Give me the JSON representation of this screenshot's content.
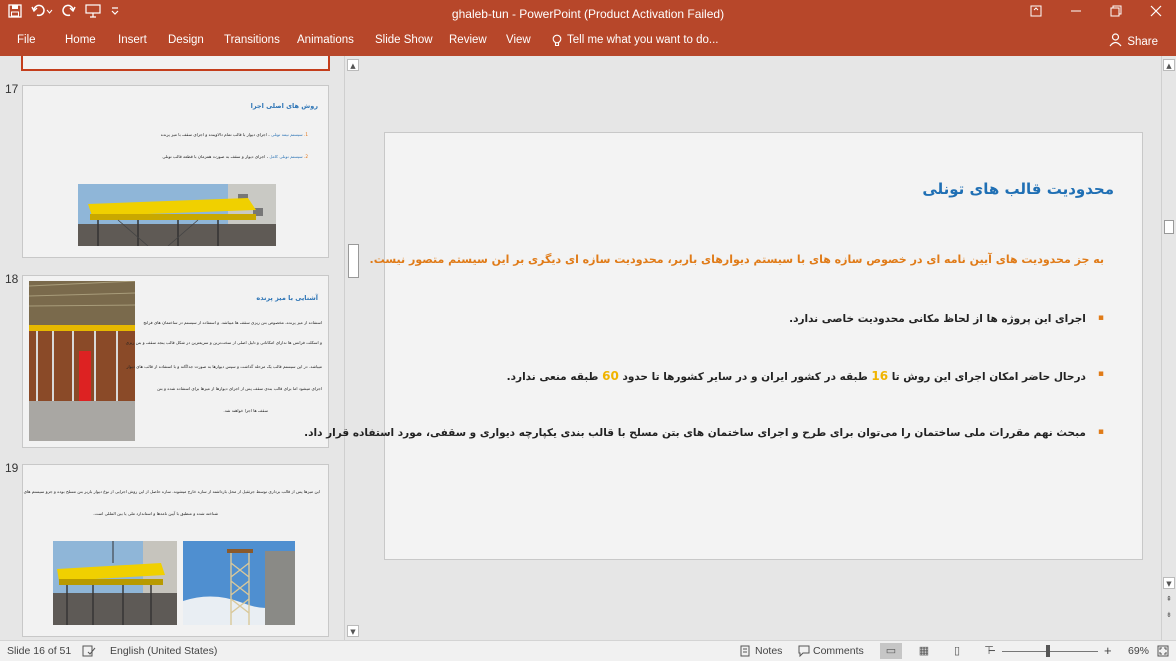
{
  "window": {
    "title": "ghaleb-tun  -  PowerPoint (Product Activation Failed)",
    "qat_icons": [
      "save-icon",
      "undo-icon",
      "redo-icon",
      "present-icon",
      "customize-icon"
    ]
  },
  "ribbon": {
    "file": "File",
    "tabs": [
      "Home",
      "Insert",
      "Design",
      "Transitions",
      "Animations",
      "Slide Show",
      "Review",
      "View"
    ],
    "tell_me": "Tell me what you want to do...",
    "share": "Share"
  },
  "thumbnails": [
    {
      "number": "17",
      "title": "روش های اصلی اجرا",
      "lines": [
        {
          "num": "1.",
          "blue": "سیستم نیمه تونلی",
          "text": "، اجرای دیوار با قالب تمام دالاوینده و اجرای سقف با میز پرنده"
        },
        {
          "num": "2.",
          "blue": "سیستم تونلی کامل",
          "text": "، اجرای دیوار و سقف به صورت همزمان با قطعه قالب تونلی"
        }
      ]
    },
    {
      "number": "18",
      "title": "آشنایی با میز پرنده",
      "lines": [
        {
          "text": "استفاده از میز پرنده، مخصوص بتن ریزی سقف ها میباشد. و استفاده از سیستم در ساختمان های فرانچ"
        },
        {
          "text": "و اسکلت فرانس ها ندارای امکاناتی و دلیل اصلی از سخت‌ترین و سریعترین در شکل قالب ینجد سقف و بتن ریزی"
        },
        {
          "text": "میباشد. در این سیستم قالب یک مرحله گذاشت و سپس دیوارها به صورت جداگانه و با استفاده از قالب های دیوار"
        },
        {
          "text": "اجرای میشود اما برای قالب بندی سقف پس از اجرای دیوارها از میزها برای استفاده شده و بتن"
        },
        {
          "text": "سقف ها اجرا خواهند شد."
        }
      ]
    },
    {
      "number": "19",
      "lines": [
        {
          "text": "این میزها پس از قالب برداری توسط جرثقیل از محل بارداشته از سازه خارج میشوند. سازه حاصل از این روش اجرایی از نوع دیوار باربر بتن مسلح بوده و جزو سیستم های"
        },
        {
          "text": "شناخته شده و منطبق با آیین نامه‌ها و استاندارد ملی یا بین المللی است."
        }
      ]
    }
  ],
  "slide": {
    "title": "محدودیت قالب های تونلی",
    "subtitle": "به جز محدودیت های آیین نامه ای در خصوص سازه های با سیستم دیوارهای باربر، محدودیت سازه ای دیگری بر این سیستم متصور نیست.",
    "bullets": [
      {
        "text": "اجرای این پروژه ها از لحاظ مکانی محدودیت خاصی ندارد."
      },
      {
        "pre": "درحال حاضر امکان اجرای این روش تا",
        "n1": "16",
        "mid": "طبقه در کشور ایران و در سایر کشورها تا حدود",
        "n2": "60",
        "post": "طبقه منعی ندارد."
      },
      {
        "text": "مبحث نهم مقررات ملی ساختمان را می‌توان برای طرح و اجرای ساختمان های بتن مسلح با قالب بندی یکپارچه دیواری و سقفی، مورد استفاده قرار داد."
      }
    ],
    "bullet_mark": "▪"
  },
  "status": {
    "slide_of": "Slide 16 of 51",
    "language": "English (United States)",
    "notes": "Notes",
    "comments": "Comments",
    "zoom": "69%",
    "zoom_level_percent": 69
  },
  "colors": {
    "ribbon": "#b7472a",
    "title_blue": "#1f6fb4",
    "accent_orange": "#e07b18",
    "highlight_yellow": "#f0b400"
  }
}
